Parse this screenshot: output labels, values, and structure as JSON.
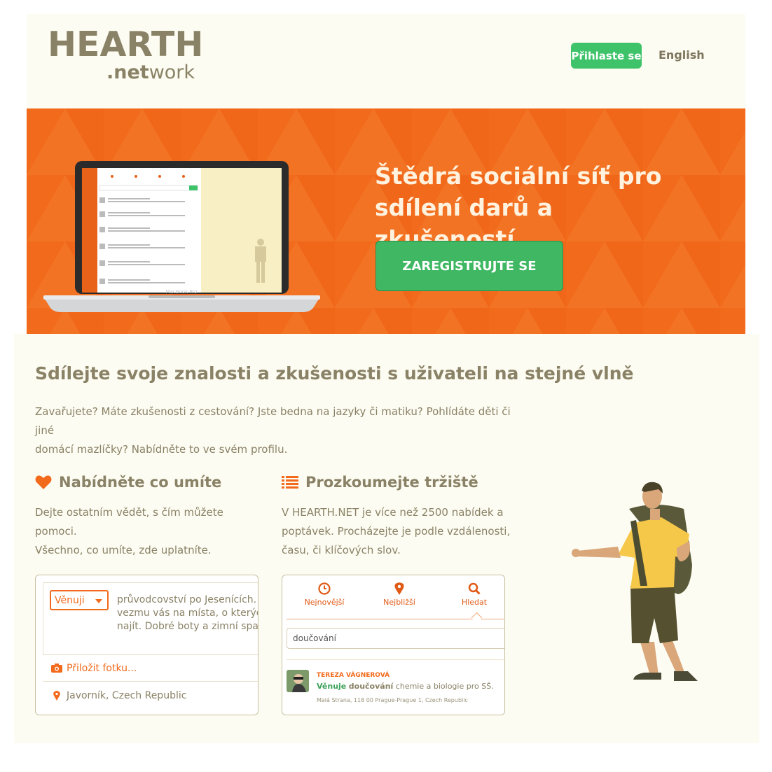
{
  "header": {
    "logo_main": "HEARTH",
    "logo_sub_bold": ".net",
    "logo_sub_rest": "work",
    "login_label": "Přihlaste se",
    "language_label": "English"
  },
  "hero": {
    "title_line1": "Štědrá sociální síť pro",
    "title_line2": "sdílení darů a zkušeností",
    "register_label": "ZAREGISTRUJTE SE",
    "laptop_caption": "MacBook Pro"
  },
  "main": {
    "heading": "Sdílejte svoje znalosti a zkušenosti s uživateli na stejné vlně",
    "intro_line1": "Zavařujete? Máte zkušenosti z cestování? Jste bedna na jazyky či matiku? Pohlídáte děti či jiné",
    "intro_line2": "domácí mazlíčky? Nabídněte to ve svém profilu.",
    "col1": {
      "heading": "Nabídněte co umíte",
      "icon": "heart-icon",
      "line1": "Dejte ostatním vědět, s čím můžete pomoci.",
      "line2": "Všechno, co umíte, zde uplatníte.",
      "select_value": "Věnuji",
      "offer_line1": "průvodcovství po Jesenících. Peš",
      "offer_line2": "vezmu vás na místa, o kterých jst",
      "offer_line3": "najít. Dobré boty a zimní spacák p",
      "attach_label": "Přiložit fotku...",
      "location_label": "Javorník, Czech Republic"
    },
    "col2": {
      "heading": "Prozkoumejte tržiště",
      "icon": "list-icon",
      "line1": "V HEARTH.NET je více než 2500 nabídek a",
      "line2": "poptávek. Procházejte je podle vzdálenosti,",
      "line3": "času, či klíčových slov.",
      "tabs": [
        "Nejnovější",
        "Nejbližší",
        "Hledat"
      ],
      "search_value": "doučování",
      "result_name": "TEREZA VÁGNEROVÁ",
      "result_verb": "Věnuje",
      "result_keyword": "doučování",
      "result_rest": " chemie a biologie pro SŠ.",
      "result_address": "Malá Strana, 118 00 Prague-Prague 1, Czech Republic"
    }
  },
  "colors": {
    "accent_orange": "#f26a1b",
    "accent_green": "#3fc36a",
    "text_olive": "#8a8266",
    "page_bg": "#fdfcf2"
  }
}
